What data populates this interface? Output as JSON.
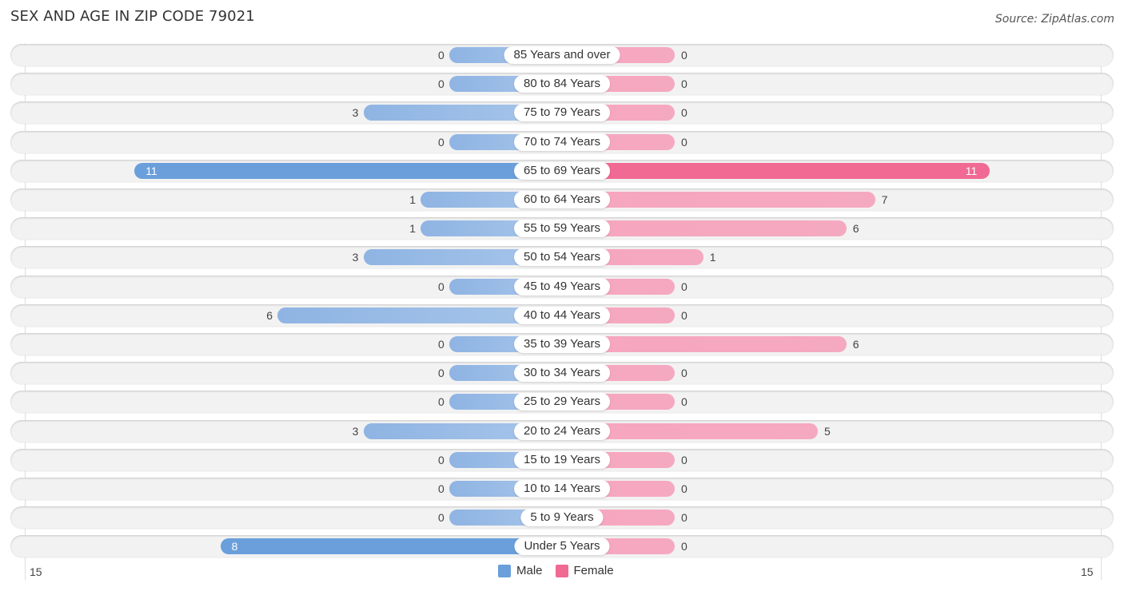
{
  "header": {
    "title": "SEX AND AGE IN ZIP CODE 79021",
    "source": "Source: ZipAtlas.com"
  },
  "colors": {
    "male": "#6a9fdb",
    "male_light": "#a7c6ea",
    "female": "#f06a93",
    "female_light": "#f5a9c0"
  },
  "chart_data": {
    "type": "bar",
    "orientation": "horizontal-diverging",
    "title": "SEX AND AGE IN ZIP CODE 79021",
    "categories": [
      "85 Years and over",
      "80 to 84 Years",
      "75 to 79 Years",
      "70 to 74 Years",
      "65 to 69 Years",
      "60 to 64 Years",
      "55 to 59 Years",
      "50 to 54 Years",
      "45 to 49 Years",
      "40 to 44 Years",
      "35 to 39 Years",
      "30 to 34 Years",
      "25 to 29 Years",
      "20 to 24 Years",
      "15 to 19 Years",
      "10 to 14 Years",
      "5 to 9 Years",
      "Under 5 Years"
    ],
    "series": [
      {
        "name": "Male",
        "values": [
          0,
          0,
          3,
          0,
          11,
          1,
          1,
          3,
          0,
          6,
          0,
          0,
          0,
          3,
          0,
          0,
          0,
          8
        ]
      },
      {
        "name": "Female",
        "values": [
          0,
          0,
          0,
          0,
          11,
          7,
          6,
          1,
          0,
          0,
          6,
          0,
          0,
          5,
          0,
          0,
          0,
          0
        ]
      }
    ],
    "axis": {
      "left_label": "15",
      "right_label": "15",
      "range": [
        0,
        15
      ]
    },
    "legend": {
      "position": "bottom-center",
      "entries": [
        "Male",
        "Female"
      ]
    },
    "grid": false
  }
}
